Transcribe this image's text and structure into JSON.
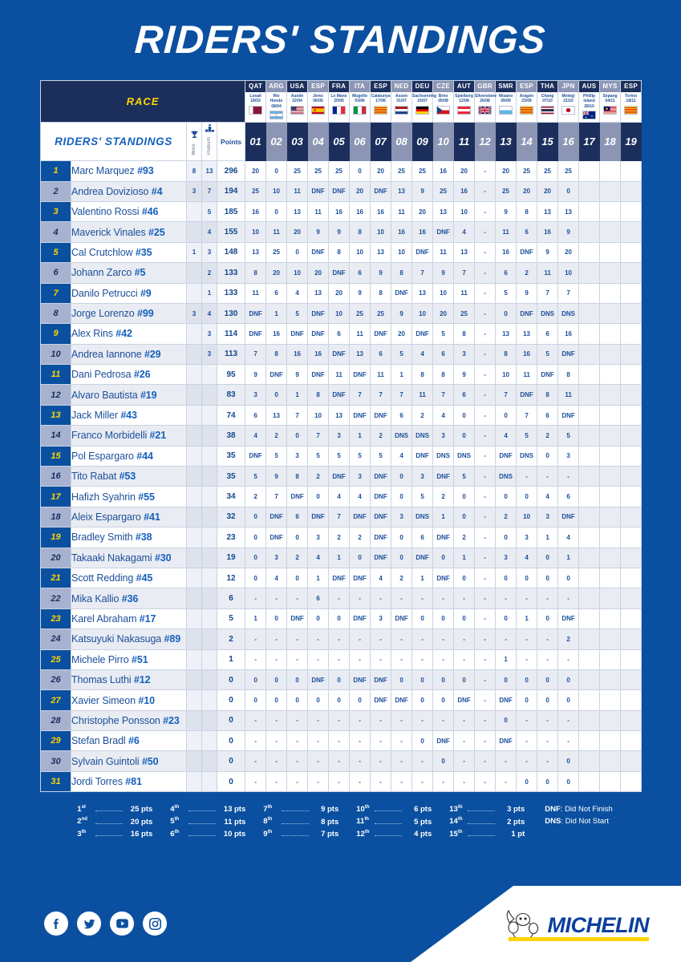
{
  "page": {
    "title": "RIDERS' STANDINGS",
    "accent_blue": "#0b50a0",
    "navy": "#1c2f5c",
    "yellow": "#ffd400"
  },
  "header": {
    "race_label": "RACE",
    "standings_label": "RIDERS' STANDINGS",
    "wins_label": "Wins",
    "podium_label": "Podium",
    "points_label": "Points",
    "wins_icon": "trophy-icon",
    "podium_icon": "podium-icon"
  },
  "races": [
    {
      "round": "01",
      "code": "QAT",
      "venue": "Losail",
      "date": "18/03",
      "flag": "qat"
    },
    {
      "round": "02",
      "code": "ARG",
      "venue": "Rio Hondo",
      "date": "08/04",
      "flag": "arg"
    },
    {
      "round": "03",
      "code": "USA",
      "venue": "Austin",
      "date": "22/04",
      "flag": "usa"
    },
    {
      "round": "04",
      "code": "ESP",
      "venue": "Jerez",
      "date": "06/05",
      "flag": "esp"
    },
    {
      "round": "05",
      "code": "FRA",
      "venue": "Le Mans",
      "date": "20/05",
      "flag": "fra"
    },
    {
      "round": "06",
      "code": "ITA",
      "venue": "Mugello",
      "date": "03/06",
      "flag": "ita"
    },
    {
      "round": "07",
      "code": "ESP",
      "venue": "Catalunya",
      "date": "17/06",
      "flag": "cat"
    },
    {
      "round": "08",
      "code": "NED",
      "venue": "Assen",
      "date": "01/07",
      "flag": "ned"
    },
    {
      "round": "09",
      "code": "DEU",
      "venue": "Sachsenring",
      "date": "15/07",
      "flag": "deu"
    },
    {
      "round": "10",
      "code": "CZE",
      "venue": "Brno",
      "date": "05/08",
      "flag": "cze"
    },
    {
      "round": "11",
      "code": "AUT",
      "venue": "Spielberg",
      "date": "12/08",
      "flag": "aut"
    },
    {
      "round": "12",
      "code": "GBR",
      "venue": "Silverstone",
      "date": "26/08",
      "flag": "gbr"
    },
    {
      "round": "13",
      "code": "SMR",
      "venue": "Misano",
      "date": "09/09",
      "flag": "smr"
    },
    {
      "round": "14",
      "code": "ESP",
      "venue": "Aragón",
      "date": "23/09",
      "flag": "cat"
    },
    {
      "round": "15",
      "code": "THA",
      "venue": "Chang",
      "date": "07/10",
      "flag": "tha"
    },
    {
      "round": "16",
      "code": "JPN",
      "venue": "Motegi",
      "date": "21/10",
      "flag": "jpn"
    },
    {
      "round": "17",
      "code": "AUS",
      "venue": "Phillip Island",
      "date": "28/10",
      "flag": "aus"
    },
    {
      "round": "18",
      "code": "MYS",
      "venue": "Sepang",
      "date": "04/11",
      "flag": "mys"
    },
    {
      "round": "19",
      "code": "ESP",
      "venue": "Torino",
      "date": "18/11",
      "flag": "cat"
    }
  ],
  "riders": [
    {
      "rank": "1",
      "name": "Marc Marquez",
      "num": "#93",
      "wins": "8",
      "podium": "13",
      "points": "296",
      "results": [
        "20",
        "0",
        "25",
        "25",
        "25",
        "0",
        "20",
        "25",
        "25",
        "16",
        "20",
        "-",
        "20",
        "25",
        "25",
        "25",
        "",
        "",
        ""
      ]
    },
    {
      "rank": "2",
      "name": "Andrea Dovizioso",
      "num": "#4",
      "wins": "3",
      "podium": "7",
      "points": "194",
      "results": [
        "25",
        "10",
        "11",
        "DNF",
        "DNF",
        "20",
        "DNF",
        "13",
        "9",
        "25",
        "16",
        "-",
        "25",
        "20",
        "20",
        "0",
        "",
        "",
        ""
      ]
    },
    {
      "rank": "3",
      "name": "Valentino Rossi",
      "num": "#46",
      "wins": "",
      "podium": "5",
      "points": "185",
      "results": [
        "16",
        "0",
        "13",
        "11",
        "16",
        "16",
        "16",
        "11",
        "20",
        "13",
        "10",
        "-",
        "9",
        "8",
        "13",
        "13",
        "",
        "",
        ""
      ]
    },
    {
      "rank": "4",
      "name": "Maverick Vinales",
      "num": "#25",
      "wins": "",
      "podium": "4",
      "points": "155",
      "results": [
        "10",
        "11",
        "20",
        "9",
        "9",
        "8",
        "10",
        "16",
        "16",
        "DNF",
        "4",
        "-",
        "11",
        "6",
        "16",
        "9",
        "",
        "",
        ""
      ]
    },
    {
      "rank": "5",
      "name": "Cal Crutchlow",
      "num": "#35",
      "wins": "1",
      "podium": "3",
      "points": "148",
      "results": [
        "13",
        "25",
        "0",
        "DNF",
        "8",
        "10",
        "13",
        "10",
        "DNF",
        "11",
        "13",
        "-",
        "16",
        "DNF",
        "9",
        "20",
        "",
        "",
        ""
      ]
    },
    {
      "rank": "6",
      "name": "Johann Zarco",
      "num": "#5",
      "wins": "",
      "podium": "2",
      "points": "133",
      "results": [
        "8",
        "20",
        "10",
        "20",
        "DNF",
        "6",
        "9",
        "8",
        "7",
        "9",
        "7",
        "-",
        "6",
        "2",
        "11",
        "10",
        "",
        "",
        ""
      ]
    },
    {
      "rank": "7",
      "name": "Danilo Petrucci",
      "num": "#9",
      "wins": "",
      "podium": "1",
      "points": "133",
      "results": [
        "11",
        "6",
        "4",
        "13",
        "20",
        "9",
        "8",
        "DNF",
        "13",
        "10",
        "11",
        "-",
        "5",
        "9",
        "7",
        "7",
        "",
        "",
        ""
      ]
    },
    {
      "rank": "8",
      "name": "Jorge Lorenzo",
      "num": "#99",
      "wins": "3",
      "podium": "4",
      "points": "130",
      "results": [
        "DNF",
        "1",
        "5",
        "DNF",
        "10",
        "25",
        "25",
        "9",
        "10",
        "20",
        "25",
        "-",
        "0",
        "DNF",
        "DNS",
        "DNS",
        "",
        "",
        ""
      ]
    },
    {
      "rank": "9",
      "name": "Alex Rins",
      "num": "#42",
      "wins": "",
      "podium": "3",
      "points": "114",
      "results": [
        "DNF",
        "16",
        "DNF",
        "DNF",
        "6",
        "11",
        "DNF",
        "20",
        "DNF",
        "5",
        "8",
        "-",
        "13",
        "13",
        "6",
        "16",
        "",
        "",
        ""
      ]
    },
    {
      "rank": "10",
      "name": "Andrea Iannone",
      "num": "#29",
      "wins": "",
      "podium": "3",
      "points": "113",
      "results": [
        "7",
        "8",
        "16",
        "16",
        "DNF",
        "13",
        "6",
        "5",
        "4",
        "6",
        "3",
        "-",
        "8",
        "16",
        "5",
        "DNF",
        "",
        "",
        ""
      ]
    },
    {
      "rank": "11",
      "name": "Dani Pedrosa",
      "num": "#26",
      "wins": "",
      "podium": "",
      "points": "95",
      "results": [
        "9",
        "DNF",
        "9",
        "DNF",
        "11",
        "DNF",
        "11",
        "1",
        "8",
        "8",
        "9",
        "-",
        "10",
        "11",
        "DNF",
        "8",
        "",
        "",
        ""
      ]
    },
    {
      "rank": "12",
      "name": "Alvaro Bautista",
      "num": "#19",
      "wins": "",
      "podium": "",
      "points": "83",
      "results": [
        "3",
        "0",
        "1",
        "8",
        "DNF",
        "7",
        "7",
        "7",
        "11",
        "7",
        "6",
        "-",
        "7",
        "DNF",
        "8",
        "11",
        "",
        "",
        ""
      ]
    },
    {
      "rank": "13",
      "name": "Jack Miller",
      "num": "#43",
      "wins": "",
      "podium": "",
      "points": "74",
      "results": [
        "6",
        "13",
        "7",
        "10",
        "13",
        "DNF",
        "DNF",
        "6",
        "2",
        "4",
        "0",
        "-",
        "0",
        "7",
        "6",
        "DNF",
        "",
        "",
        ""
      ]
    },
    {
      "rank": "14",
      "name": "Franco Morbidelli",
      "num": "#21",
      "wins": "",
      "podium": "",
      "points": "38",
      "results": [
        "4",
        "2",
        "0",
        "7",
        "3",
        "1",
        "2",
        "DNS",
        "DNS",
        "3",
        "0",
        "-",
        "4",
        "5",
        "2",
        "5",
        "",
        "",
        ""
      ]
    },
    {
      "rank": "15",
      "name": "Pol Espargaro",
      "num": "#44",
      "wins": "",
      "podium": "",
      "points": "35",
      "results": [
        "DNF",
        "5",
        "3",
        "5",
        "5",
        "5",
        "5",
        "4",
        "DNF",
        "DNS",
        "DNS",
        "-",
        "DNF",
        "DNS",
        "0",
        "3",
        "",
        "",
        ""
      ]
    },
    {
      "rank": "16",
      "name": "Tito Rabat",
      "num": "#53",
      "wins": "",
      "podium": "",
      "points": "35",
      "results": [
        "5",
        "9",
        "8",
        "2",
        "DNF",
        "3",
        "DNF",
        "0",
        "3",
        "DNF",
        "5",
        "-",
        "DNS",
        "-",
        "-",
        "-",
        "",
        "",
        ""
      ]
    },
    {
      "rank": "17",
      "name": "Hafizh Syahrin",
      "num": "#55",
      "wins": "",
      "podium": "",
      "points": "34",
      "results": [
        "2",
        "7",
        "DNF",
        "0",
        "4",
        "4",
        "DNF",
        "0",
        "5",
        "2",
        "0",
        "-",
        "0",
        "0",
        "4",
        "6",
        "",
        "",
        ""
      ]
    },
    {
      "rank": "18",
      "name": "Aleix Espargaro",
      "num": "#41",
      "wins": "",
      "podium": "",
      "points": "32",
      "results": [
        "0",
        "DNF",
        "6",
        "DNF",
        "7",
        "DNF",
        "DNF",
        "3",
        "DNS",
        "1",
        "0",
        "-",
        "2",
        "10",
        "3",
        "DNF",
        "",
        "",
        ""
      ]
    },
    {
      "rank": "19",
      "name": "Bradley Smith",
      "num": "#38",
      "wins": "",
      "podium": "",
      "points": "23",
      "results": [
        "0",
        "DNF",
        "0",
        "3",
        "2",
        "2",
        "DNF",
        "0",
        "6",
        "DNF",
        "2",
        "-",
        "0",
        "3",
        "1",
        "4",
        "",
        "",
        ""
      ]
    },
    {
      "rank": "20",
      "name": "Takaaki Nakagami",
      "num": "#30",
      "wins": "",
      "podium": "",
      "points": "19",
      "results": [
        "0",
        "3",
        "2",
        "4",
        "1",
        "0",
        "DNF",
        "0",
        "DNF",
        "0",
        "1",
        "-",
        "3",
        "4",
        "0",
        "1",
        "",
        "",
        ""
      ]
    },
    {
      "rank": "21",
      "name": "Scott Redding",
      "num": "#45",
      "wins": "",
      "podium": "",
      "points": "12",
      "results": [
        "0",
        "4",
        "0",
        "1",
        "DNF",
        "DNF",
        "4",
        "2",
        "1",
        "DNF",
        "0",
        "-",
        "0",
        "0",
        "0",
        "0",
        "",
        "",
        ""
      ]
    },
    {
      "rank": "22",
      "name": "Mika Kallio",
      "num": "#36",
      "wins": "",
      "podium": "",
      "points": "6",
      "results": [
        "-",
        "-",
        "-",
        "6",
        "-",
        "-",
        "-",
        "-",
        "-",
        "-",
        "-",
        "-",
        "-",
        "-",
        "-",
        "-",
        "",
        "",
        ""
      ]
    },
    {
      "rank": "23",
      "name": "Karel Abraham",
      "num": "#17",
      "wins": "",
      "podium": "",
      "points": "5",
      "results": [
        "1",
        "0",
        "DNF",
        "0",
        "0",
        "DNF",
        "3",
        "DNF",
        "0",
        "0",
        "0",
        "-",
        "0",
        "1",
        "0",
        "DNF",
        "",
        "",
        ""
      ]
    },
    {
      "rank": "24",
      "name": "Katsuyuki Nakasuga",
      "num": "#89",
      "wins": "",
      "podium": "",
      "points": "2",
      "results": [
        "-",
        "-",
        "-",
        "-",
        "-",
        "-",
        "-",
        "-",
        "-",
        "-",
        "-",
        "-",
        "-",
        "-",
        "-",
        "2",
        "",
        "",
        ""
      ]
    },
    {
      "rank": "25",
      "name": "Michele Pirro",
      "num": "#51",
      "wins": "",
      "podium": "",
      "points": "1",
      "results": [
        "-",
        "-",
        "-",
        "-",
        "-",
        "-",
        "-",
        "-",
        "-",
        "-",
        "-",
        "-",
        "1",
        "-",
        "-",
        "-",
        "",
        "",
        ""
      ]
    },
    {
      "rank": "26",
      "name": "Thomas Luthi",
      "num": "#12",
      "wins": "",
      "podium": "",
      "points": "0",
      "results": [
        "0",
        "0",
        "0",
        "DNF",
        "0",
        "DNF",
        "DNF",
        "0",
        "0",
        "0",
        "0",
        "-",
        "0",
        "0",
        "0",
        "0",
        "",
        "",
        ""
      ]
    },
    {
      "rank": "27",
      "name": "Xavier Simeon",
      "num": "#10",
      "wins": "",
      "podium": "",
      "points": "0",
      "results": [
        "0",
        "0",
        "0",
        "0",
        "0",
        "0",
        "DNF",
        "DNF",
        "0",
        "0",
        "DNF",
        "-",
        "DNF",
        "0",
        "0",
        "0",
        "",
        "",
        ""
      ]
    },
    {
      "rank": "28",
      "name": "Christophe Ponsson",
      "num": "#23",
      "wins": "",
      "podium": "",
      "points": "0",
      "results": [
        "-",
        "-",
        "-",
        "-",
        "-",
        "-",
        "-",
        "-",
        "-",
        "-",
        "-",
        "-",
        "0",
        "-",
        "-",
        "-",
        "",
        "",
        ""
      ]
    },
    {
      "rank": "29",
      "name": "Stefan Bradl",
      "num": "#6",
      "wins": "",
      "podium": "",
      "points": "0",
      "results": [
        "-",
        "-",
        "-",
        "-",
        "-",
        "-",
        "-",
        "-",
        "0",
        "DNF",
        "-",
        "-",
        "DNF",
        "-",
        "-",
        "-",
        "",
        "",
        ""
      ]
    },
    {
      "rank": "30",
      "name": "Sylvain Guintoli",
      "num": "#50",
      "wins": "",
      "podium": "",
      "points": "0",
      "results": [
        "-",
        "-",
        "-",
        "-",
        "-",
        "-",
        "-",
        "-",
        "-",
        "0",
        "-",
        "-",
        "-",
        "-",
        "-",
        "0",
        "",
        "",
        ""
      ]
    },
    {
      "rank": "31",
      "name": "Jordi Torres",
      "num": "#81",
      "wins": "",
      "podium": "",
      "points": "0",
      "results": [
        "-",
        "-",
        "-",
        "-",
        "-",
        "-",
        "-",
        "-",
        "-",
        "-",
        "-",
        "-",
        "-",
        "0",
        "0",
        "0",
        "",
        "",
        ""
      ]
    }
  ],
  "legend": {
    "columns": [
      [
        {
          "pos": "1",
          "sup": "st",
          "pts": "25 pts"
        },
        {
          "pos": "2",
          "sup": "nd",
          "pts": "20 pts"
        },
        {
          "pos": "3",
          "sup": "th",
          "pts": "16 pts"
        }
      ],
      [
        {
          "pos": "4",
          "sup": "th",
          "pts": "13 pts"
        },
        {
          "pos": "5",
          "sup": "th",
          "pts": "11 pts"
        },
        {
          "pos": "6",
          "sup": "th",
          "pts": "10 pts"
        }
      ],
      [
        {
          "pos": "7",
          "sup": "th",
          "pts": "9 pts"
        },
        {
          "pos": "8",
          "sup": "th",
          "pts": "8 pts"
        },
        {
          "pos": "9",
          "sup": "th",
          "pts": "7 pts"
        }
      ],
      [
        {
          "pos": "10",
          "sup": "th",
          "pts": "6 pts"
        },
        {
          "pos": "11",
          "sup": "th",
          "pts": "5 pts"
        },
        {
          "pos": "12",
          "sup": "th",
          "pts": "4 pts"
        }
      ],
      [
        {
          "pos": "13",
          "sup": "th",
          "pts": "3 pts"
        },
        {
          "pos": "14",
          "sup": "th",
          "pts": "2 pts"
        },
        {
          "pos": "15",
          "sup": "th",
          "pts": "1 pt"
        }
      ]
    ],
    "dnf": "DNF: Did Not Finish",
    "dns": "DNS: Did Not Start"
  },
  "footer": {
    "social": [
      "facebook-icon",
      "twitter-icon",
      "youtube-icon",
      "instagram-icon"
    ],
    "brand": "MICHELIN"
  }
}
